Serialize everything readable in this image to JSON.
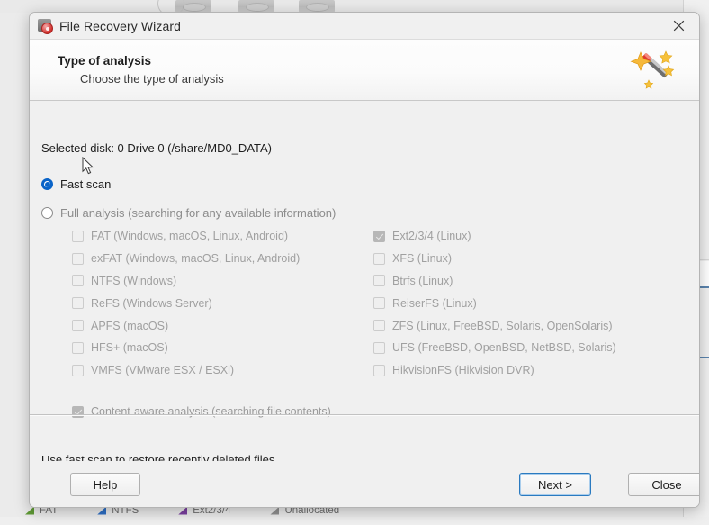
{
  "background": {
    "legend": [
      {
        "label": "FAT",
        "color": "#5f9a35"
      },
      {
        "label": "NTFS",
        "color": "#2e6fc4"
      },
      {
        "label": "Ext2/3/4",
        "color": "#7b3fa0"
      },
      {
        "label": "Unallocated",
        "color": "#909090"
      }
    ]
  },
  "dialog": {
    "title": "File Recovery Wizard",
    "title_icon": "disk-icon",
    "close_icon": "close-icon",
    "header": {
      "title": "Type of analysis",
      "subtitle": "Choose the type of analysis",
      "icon": "magic-wand-icon"
    },
    "selected_disk": "Selected disk: 0 Drive 0 (/share/MD0_DATA)",
    "scan_options": [
      {
        "label": "Fast scan",
        "checked": true,
        "disabled": false
      },
      {
        "label": "Full analysis (searching for any available information)",
        "checked": false,
        "disabled": true
      }
    ],
    "filesystems": [
      {
        "label": "FAT (Windows, macOS, Linux, Android)",
        "checked": false
      },
      {
        "label": "Ext2/3/4 (Linux)",
        "checked": true
      },
      {
        "label": "exFAT (Windows, macOS, Linux, Android)",
        "checked": false
      },
      {
        "label": "XFS (Linux)",
        "checked": false
      },
      {
        "label": "NTFS (Windows)",
        "checked": false
      },
      {
        "label": "Btrfs (Linux)",
        "checked": false
      },
      {
        "label": "ReFS (Windows Server)",
        "checked": false
      },
      {
        "label": "ReiserFS (Linux)",
        "checked": false
      },
      {
        "label": "APFS (macOS)",
        "checked": false
      },
      {
        "label": "ZFS (Linux, FreeBSD, Solaris, OpenSolaris)",
        "checked": false
      },
      {
        "label": "HFS+ (macOS)",
        "checked": false
      },
      {
        "label": "UFS (FreeBSD, OpenBSD, NetBSD, Solaris)",
        "checked": false
      },
      {
        "label": "VMFS (VMware ESX / ESXi)",
        "checked": false
      },
      {
        "label": "HikvisionFS (Hikvision DVR)",
        "checked": false
      }
    ],
    "content_aware": {
      "label": "Content-aware analysis (searching file contents)",
      "checked": true
    },
    "hint": "Use fast scan to restore recently deleted files.",
    "buttons": {
      "help": "Help",
      "next": "Next >",
      "close": "Close"
    }
  },
  "colors": {
    "accent": "#0a64c8",
    "focus_border": "#2a7ac0",
    "dialog_bg": "#f0f0f0",
    "header_bg": "#fbfbfb",
    "disabled_text": "#a0a0a0"
  }
}
